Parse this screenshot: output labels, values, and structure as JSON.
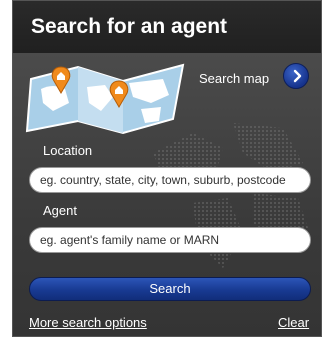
{
  "header": {
    "title": "Search for an agent"
  },
  "map": {
    "label": "Search map",
    "button_icon": "chevron-right-icon"
  },
  "location": {
    "label": "Location",
    "placeholder": "eg. country, state, city, town, suburb, postcode"
  },
  "agent": {
    "label": "Agent",
    "placeholder": "eg. agent's family name or MARN"
  },
  "search_button": {
    "label": "Search"
  },
  "links": {
    "more_options": "More search options",
    "clear": "Clear"
  },
  "colors": {
    "header_bg": "#222222",
    "panel_bg": "#3c3c3c",
    "button_blue": "#1a3c94",
    "map_pin": "#f08a1c",
    "map_sea": "#9fc6e3"
  }
}
